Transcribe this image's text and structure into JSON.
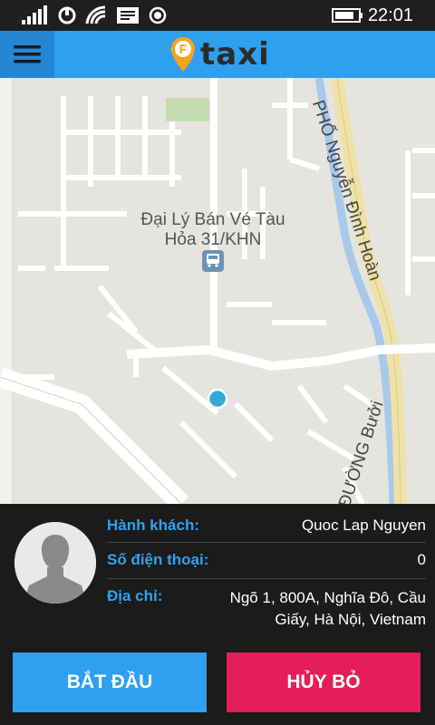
{
  "status_bar": {
    "time": "22:01",
    "icons": [
      "signal-icon",
      "sync-icon",
      "wifi-icon",
      "message-icon",
      "location-icon",
      "battery-icon"
    ]
  },
  "app_bar": {
    "logo_letter": "F",
    "logo_text": "taxi",
    "menu_icon": "hamburger-menu-icon"
  },
  "map": {
    "poi_label": "Đại Lý Bán Vé Tàu Hỏa 31/KHN",
    "poi_icon": "train-station-icon",
    "street_1": "PHỐ Nguyễn Đình Hoàn",
    "street_2": "ĐƯỜNG Bưởi"
  },
  "passenger": {
    "name_label": "Hành khách:",
    "name_value": "Quoc Lap Nguyen",
    "phone_label": "Số điện thoại:",
    "phone_value": "0",
    "address_label": "Địa chỉ:",
    "address_value": "Ngõ 1, 800A, Nghĩa Đô, Cầu Giấy, Hà Nội, Vietnam"
  },
  "actions": {
    "start_label": "BẮT ĐẦU",
    "cancel_label": "HỦY BỎ"
  },
  "colors": {
    "accent": "#2f9ff0",
    "cancel": "#e41e5a",
    "logo_orange": "#f7a21b"
  }
}
